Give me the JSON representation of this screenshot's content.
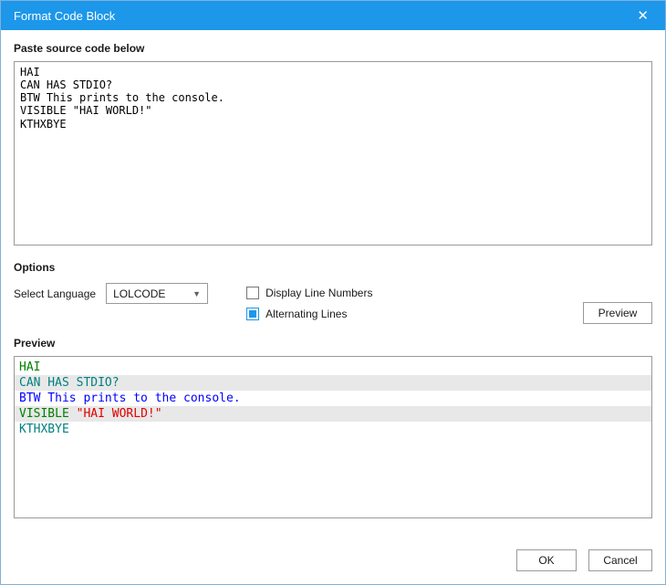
{
  "dialog": {
    "title": "Format Code Block",
    "close_glyph": "✕"
  },
  "source": {
    "label": "Paste source code below",
    "code": "HAI\nCAN HAS STDIO?\nBTW This prints to the console.\nVISIBLE \"HAI WORLD!\"\nKTHXBYE"
  },
  "options": {
    "label": "Options",
    "select_language_label": "Select Language",
    "language_value": "LOLCODE",
    "dropdown_caret": "▼",
    "display_line_numbers_label": "Display Line Numbers",
    "display_line_numbers_checked": false,
    "alternating_lines_label": "Alternating Lines",
    "alternating_lines_checked": true,
    "preview_button_label": "Preview"
  },
  "preview": {
    "label": "Preview",
    "lines": [
      {
        "alt": false,
        "segments": [
          {
            "text": "HAI",
            "color": "#008000"
          }
        ]
      },
      {
        "alt": true,
        "segments": [
          {
            "text": "CAN HAS STDIO?",
            "color": "#008080"
          }
        ]
      },
      {
        "alt": false,
        "segments": [
          {
            "text": "BTW This prints to the console.",
            "color": "#0000ff"
          }
        ]
      },
      {
        "alt": true,
        "segments": [
          {
            "text": "VISIBLE ",
            "color": "#008000"
          },
          {
            "text": "\"HAI WORLD!\"",
            "color": "#e00000"
          }
        ]
      },
      {
        "alt": false,
        "segments": [
          {
            "text": "KTHXBYE",
            "color": "#008080"
          }
        ]
      }
    ]
  },
  "footer": {
    "ok_label": "OK",
    "cancel_label": "Cancel"
  },
  "colors": {
    "accent": "#1c97ea",
    "alt_line_bg": "#e8e8e8",
    "titlebar_text": "#ffffff"
  }
}
